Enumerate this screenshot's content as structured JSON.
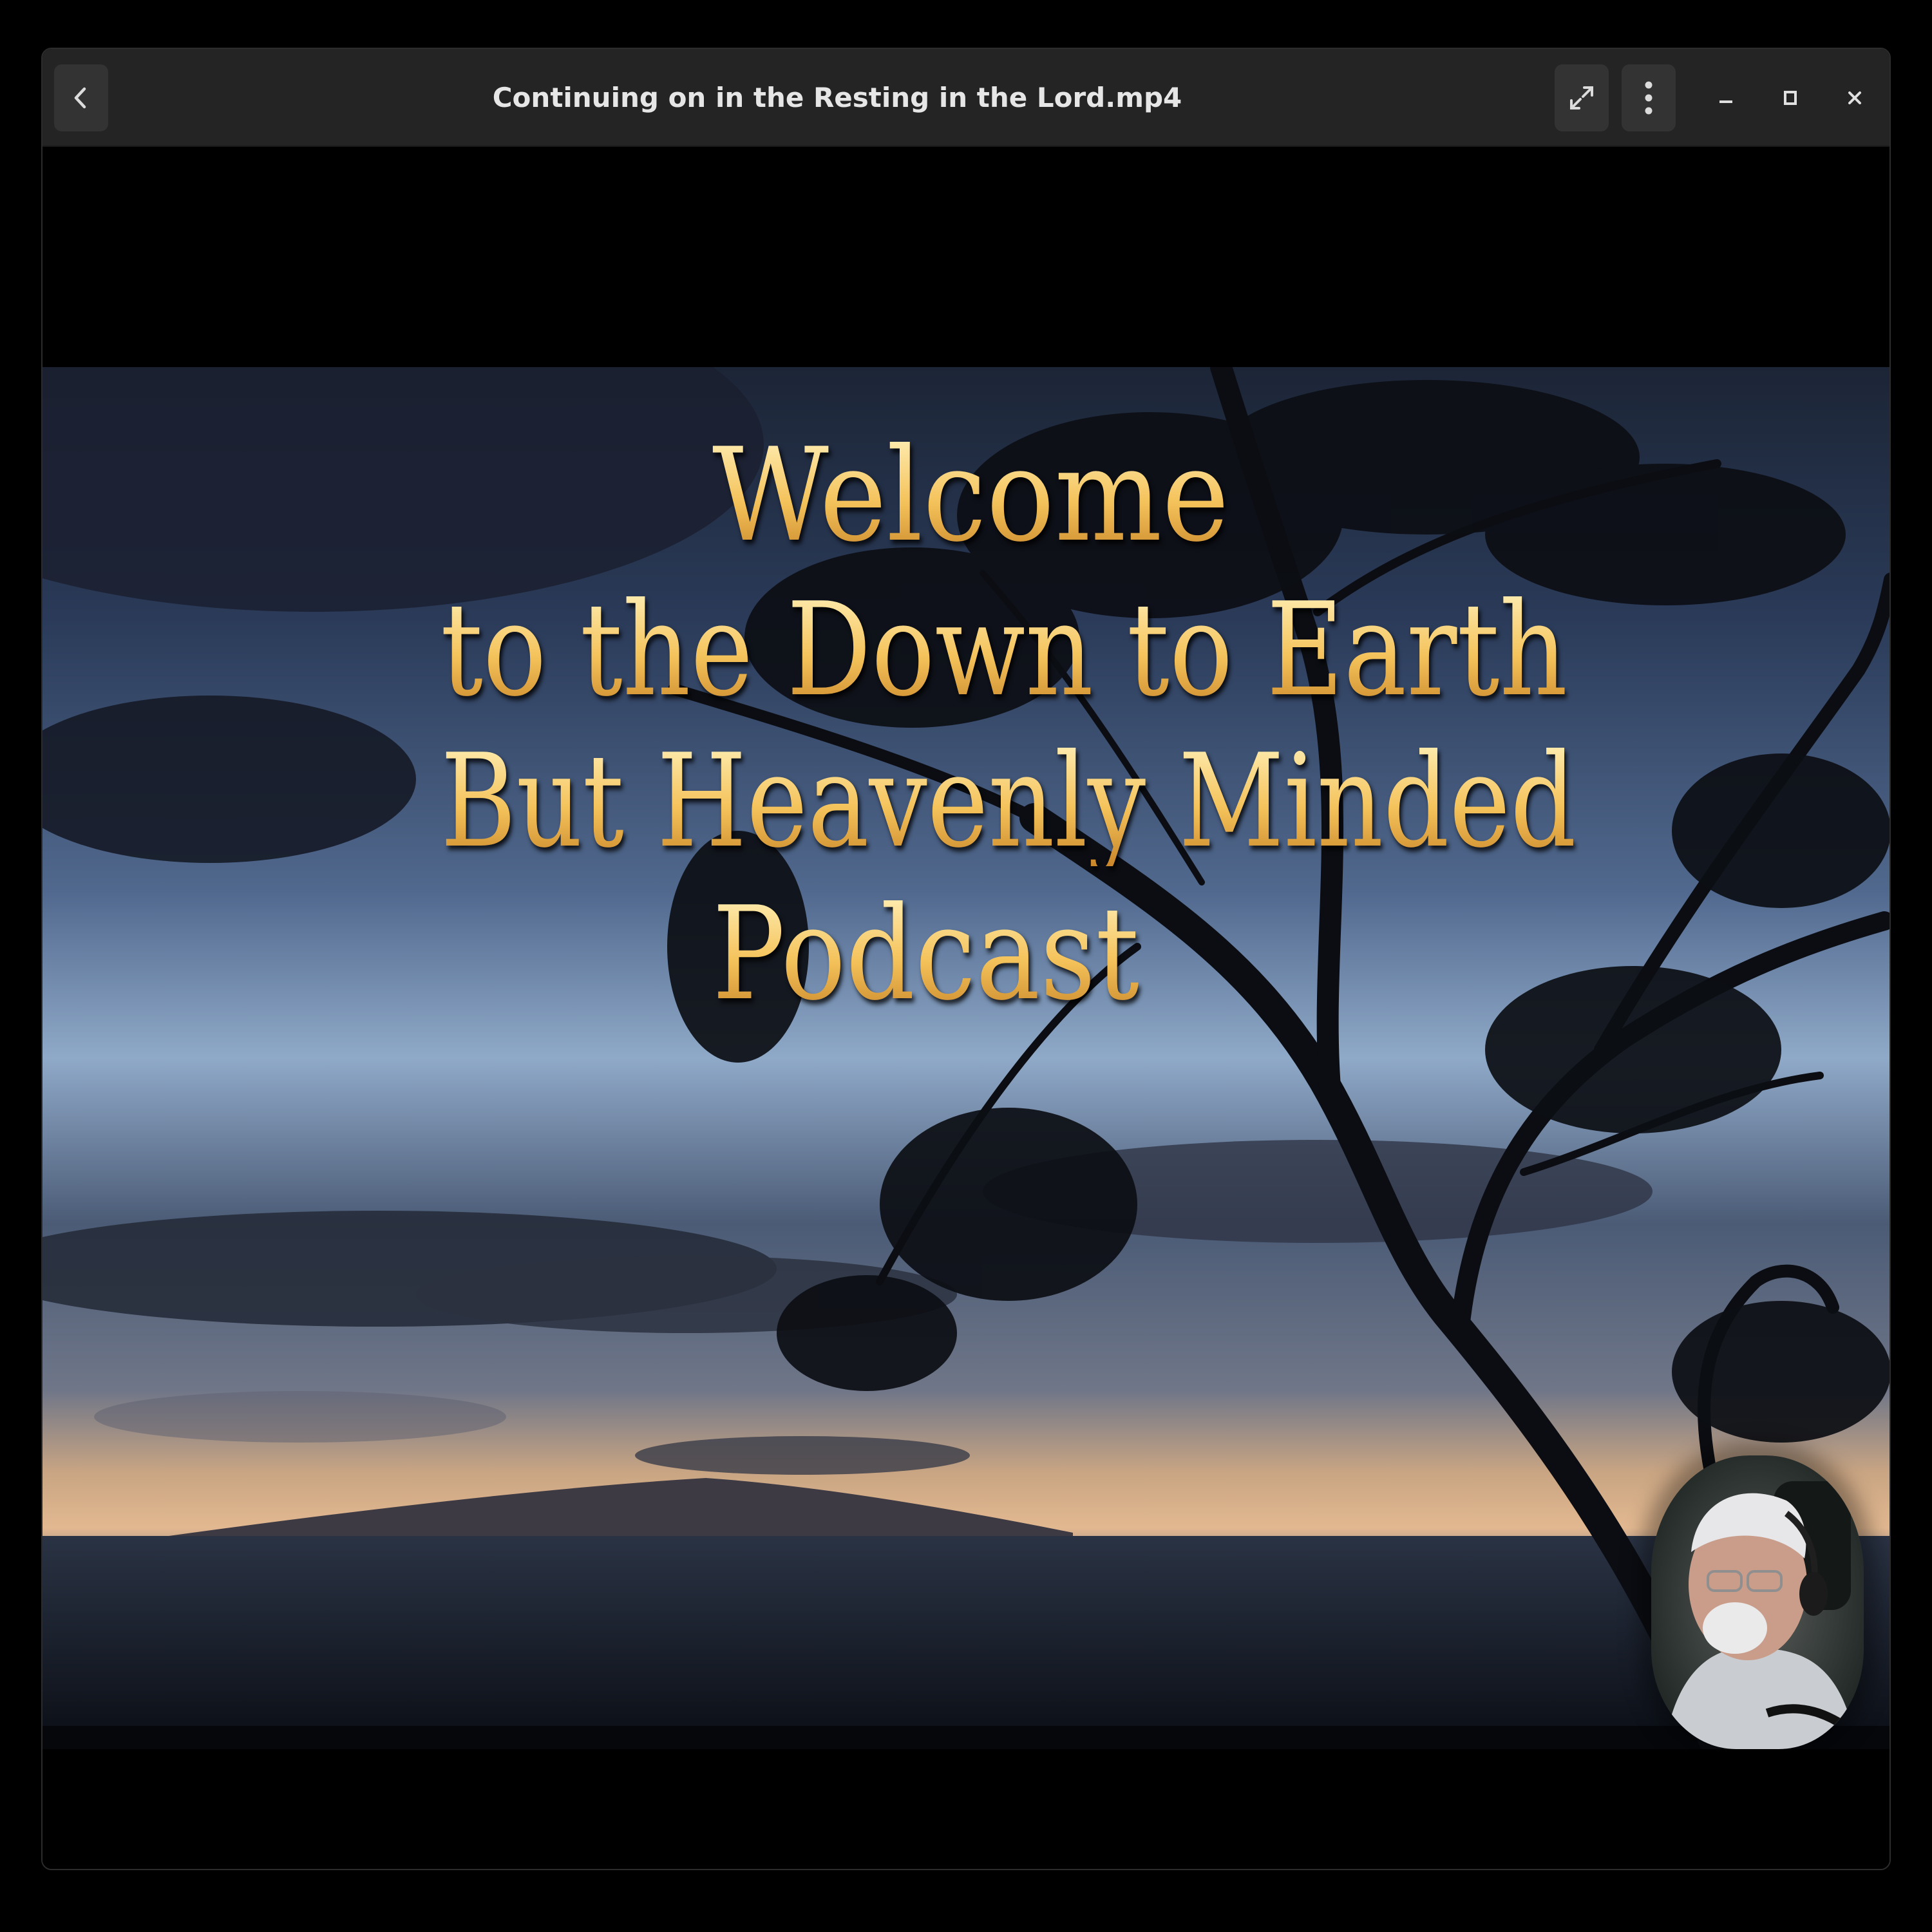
{
  "window": {
    "title": "Continuing on in the Resting in the Lord.mp4"
  },
  "headerbar": {
    "back_icon": "chevron-left-icon",
    "fullscreen_icon": "fullscreen-icon",
    "menu_icon": "kebab-menu-icon",
    "minimize_icon": "minimize-icon",
    "maximize_icon": "maximize-icon",
    "close_icon": "close-icon"
  },
  "video": {
    "overlay_lines": [
      "Welcome",
      "to the Down to Earth",
      "But Heavenly Minded",
      "Podcast"
    ],
    "text_color": "#f2c56a"
  },
  "colors": {
    "headerbar_bg": "#242424",
    "button_bg": "#333333",
    "title_text": "#e6e6e6"
  }
}
